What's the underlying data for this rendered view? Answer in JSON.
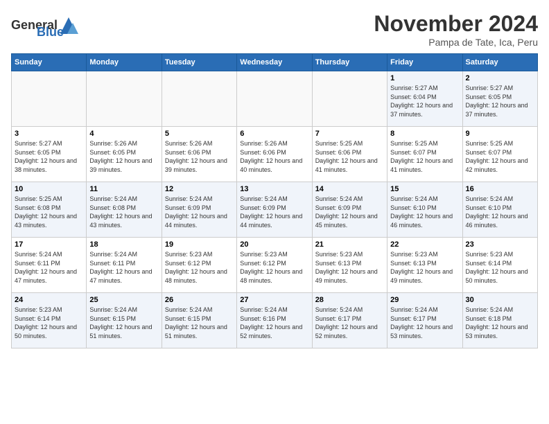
{
  "header": {
    "logo_general": "General",
    "logo_blue": "Blue",
    "month_title": "November 2024",
    "location": "Pampa de Tate, Ica, Peru"
  },
  "weekdays": [
    "Sunday",
    "Monday",
    "Tuesday",
    "Wednesday",
    "Thursday",
    "Friday",
    "Saturday"
  ],
  "weeks": [
    [
      {
        "day": "",
        "sunrise": "",
        "sunset": "",
        "daylight": ""
      },
      {
        "day": "",
        "sunrise": "",
        "sunset": "",
        "daylight": ""
      },
      {
        "day": "",
        "sunrise": "",
        "sunset": "",
        "daylight": ""
      },
      {
        "day": "",
        "sunrise": "",
        "sunset": "",
        "daylight": ""
      },
      {
        "day": "",
        "sunrise": "",
        "sunset": "",
        "daylight": ""
      },
      {
        "day": "1",
        "sunrise": "Sunrise: 5:27 AM",
        "sunset": "Sunset: 6:04 PM",
        "daylight": "Daylight: 12 hours and 37 minutes."
      },
      {
        "day": "2",
        "sunrise": "Sunrise: 5:27 AM",
        "sunset": "Sunset: 6:05 PM",
        "daylight": "Daylight: 12 hours and 37 minutes."
      }
    ],
    [
      {
        "day": "3",
        "sunrise": "Sunrise: 5:27 AM",
        "sunset": "Sunset: 6:05 PM",
        "daylight": "Daylight: 12 hours and 38 minutes."
      },
      {
        "day": "4",
        "sunrise": "Sunrise: 5:26 AM",
        "sunset": "Sunset: 6:05 PM",
        "daylight": "Daylight: 12 hours and 39 minutes."
      },
      {
        "day": "5",
        "sunrise": "Sunrise: 5:26 AM",
        "sunset": "Sunset: 6:06 PM",
        "daylight": "Daylight: 12 hours and 39 minutes."
      },
      {
        "day": "6",
        "sunrise": "Sunrise: 5:26 AM",
        "sunset": "Sunset: 6:06 PM",
        "daylight": "Daylight: 12 hours and 40 minutes."
      },
      {
        "day": "7",
        "sunrise": "Sunrise: 5:25 AM",
        "sunset": "Sunset: 6:06 PM",
        "daylight": "Daylight: 12 hours and 41 minutes."
      },
      {
        "day": "8",
        "sunrise": "Sunrise: 5:25 AM",
        "sunset": "Sunset: 6:07 PM",
        "daylight": "Daylight: 12 hours and 41 minutes."
      },
      {
        "day": "9",
        "sunrise": "Sunrise: 5:25 AM",
        "sunset": "Sunset: 6:07 PM",
        "daylight": "Daylight: 12 hours and 42 minutes."
      }
    ],
    [
      {
        "day": "10",
        "sunrise": "Sunrise: 5:25 AM",
        "sunset": "Sunset: 6:08 PM",
        "daylight": "Daylight: 12 hours and 43 minutes."
      },
      {
        "day": "11",
        "sunrise": "Sunrise: 5:24 AM",
        "sunset": "Sunset: 6:08 PM",
        "daylight": "Daylight: 12 hours and 43 minutes."
      },
      {
        "day": "12",
        "sunrise": "Sunrise: 5:24 AM",
        "sunset": "Sunset: 6:09 PM",
        "daylight": "Daylight: 12 hours and 44 minutes."
      },
      {
        "day": "13",
        "sunrise": "Sunrise: 5:24 AM",
        "sunset": "Sunset: 6:09 PM",
        "daylight": "Daylight: 12 hours and 44 minutes."
      },
      {
        "day": "14",
        "sunrise": "Sunrise: 5:24 AM",
        "sunset": "Sunset: 6:09 PM",
        "daylight": "Daylight: 12 hours and 45 minutes."
      },
      {
        "day": "15",
        "sunrise": "Sunrise: 5:24 AM",
        "sunset": "Sunset: 6:10 PM",
        "daylight": "Daylight: 12 hours and 46 minutes."
      },
      {
        "day": "16",
        "sunrise": "Sunrise: 5:24 AM",
        "sunset": "Sunset: 6:10 PM",
        "daylight": "Daylight: 12 hours and 46 minutes."
      }
    ],
    [
      {
        "day": "17",
        "sunrise": "Sunrise: 5:24 AM",
        "sunset": "Sunset: 6:11 PM",
        "daylight": "Daylight: 12 hours and 47 minutes."
      },
      {
        "day": "18",
        "sunrise": "Sunrise: 5:24 AM",
        "sunset": "Sunset: 6:11 PM",
        "daylight": "Daylight: 12 hours and 47 minutes."
      },
      {
        "day": "19",
        "sunrise": "Sunrise: 5:23 AM",
        "sunset": "Sunset: 6:12 PM",
        "daylight": "Daylight: 12 hours and 48 minutes."
      },
      {
        "day": "20",
        "sunrise": "Sunrise: 5:23 AM",
        "sunset": "Sunset: 6:12 PM",
        "daylight": "Daylight: 12 hours and 48 minutes."
      },
      {
        "day": "21",
        "sunrise": "Sunrise: 5:23 AM",
        "sunset": "Sunset: 6:13 PM",
        "daylight": "Daylight: 12 hours and 49 minutes."
      },
      {
        "day": "22",
        "sunrise": "Sunrise: 5:23 AM",
        "sunset": "Sunset: 6:13 PM",
        "daylight": "Daylight: 12 hours and 49 minutes."
      },
      {
        "day": "23",
        "sunrise": "Sunrise: 5:23 AM",
        "sunset": "Sunset: 6:14 PM",
        "daylight": "Daylight: 12 hours and 50 minutes."
      }
    ],
    [
      {
        "day": "24",
        "sunrise": "Sunrise: 5:23 AM",
        "sunset": "Sunset: 6:14 PM",
        "daylight": "Daylight: 12 hours and 50 minutes."
      },
      {
        "day": "25",
        "sunrise": "Sunrise: 5:24 AM",
        "sunset": "Sunset: 6:15 PM",
        "daylight": "Daylight: 12 hours and 51 minutes."
      },
      {
        "day": "26",
        "sunrise": "Sunrise: 5:24 AM",
        "sunset": "Sunset: 6:15 PM",
        "daylight": "Daylight: 12 hours and 51 minutes."
      },
      {
        "day": "27",
        "sunrise": "Sunrise: 5:24 AM",
        "sunset": "Sunset: 6:16 PM",
        "daylight": "Daylight: 12 hours and 52 minutes."
      },
      {
        "day": "28",
        "sunrise": "Sunrise: 5:24 AM",
        "sunset": "Sunset: 6:17 PM",
        "daylight": "Daylight: 12 hours and 52 minutes."
      },
      {
        "day": "29",
        "sunrise": "Sunrise: 5:24 AM",
        "sunset": "Sunset: 6:17 PM",
        "daylight": "Daylight: 12 hours and 53 minutes."
      },
      {
        "day": "30",
        "sunrise": "Sunrise: 5:24 AM",
        "sunset": "Sunset: 6:18 PM",
        "daylight": "Daylight: 12 hours and 53 minutes."
      }
    ]
  ]
}
